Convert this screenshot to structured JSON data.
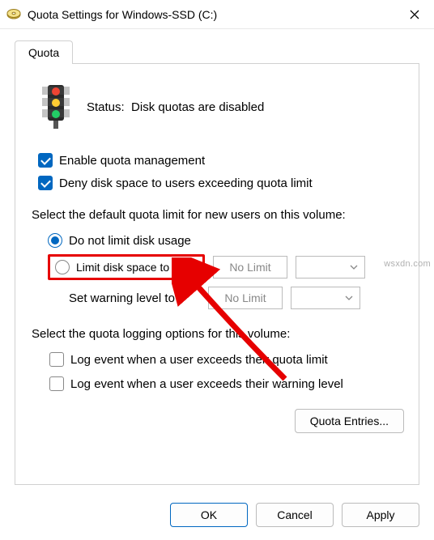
{
  "title": "Quota Settings for Windows-SSD (C:)",
  "tab_label": "Quota",
  "status_label_prefix": "Status:",
  "status_value": "Disk quotas are disabled",
  "checkboxes": {
    "enable_mgmt": "Enable quota management",
    "deny_space": "Deny disk space to users exceeding quota limit"
  },
  "section_default_limit": "Select the default quota limit for new users on this volume:",
  "radios": {
    "no_limit": "Do not limit disk usage",
    "limit_to": "Limit disk space to"
  },
  "warning_label": "Set warning level to",
  "limit_value": "No Limit",
  "limit_unit": "",
  "warn_value": "No Limit",
  "warn_unit": "",
  "section_logging": "Select the quota logging options for this volume:",
  "log_options": {
    "exceed_limit": "Log event when a user exceeds their quota limit",
    "exceed_warn": "Log event when a user exceeds their warning level"
  },
  "entries_button": "Quota Entries...",
  "footer": {
    "ok": "OK",
    "cancel": "Cancel",
    "apply": "Apply"
  },
  "watermark": "wsxdn.com"
}
